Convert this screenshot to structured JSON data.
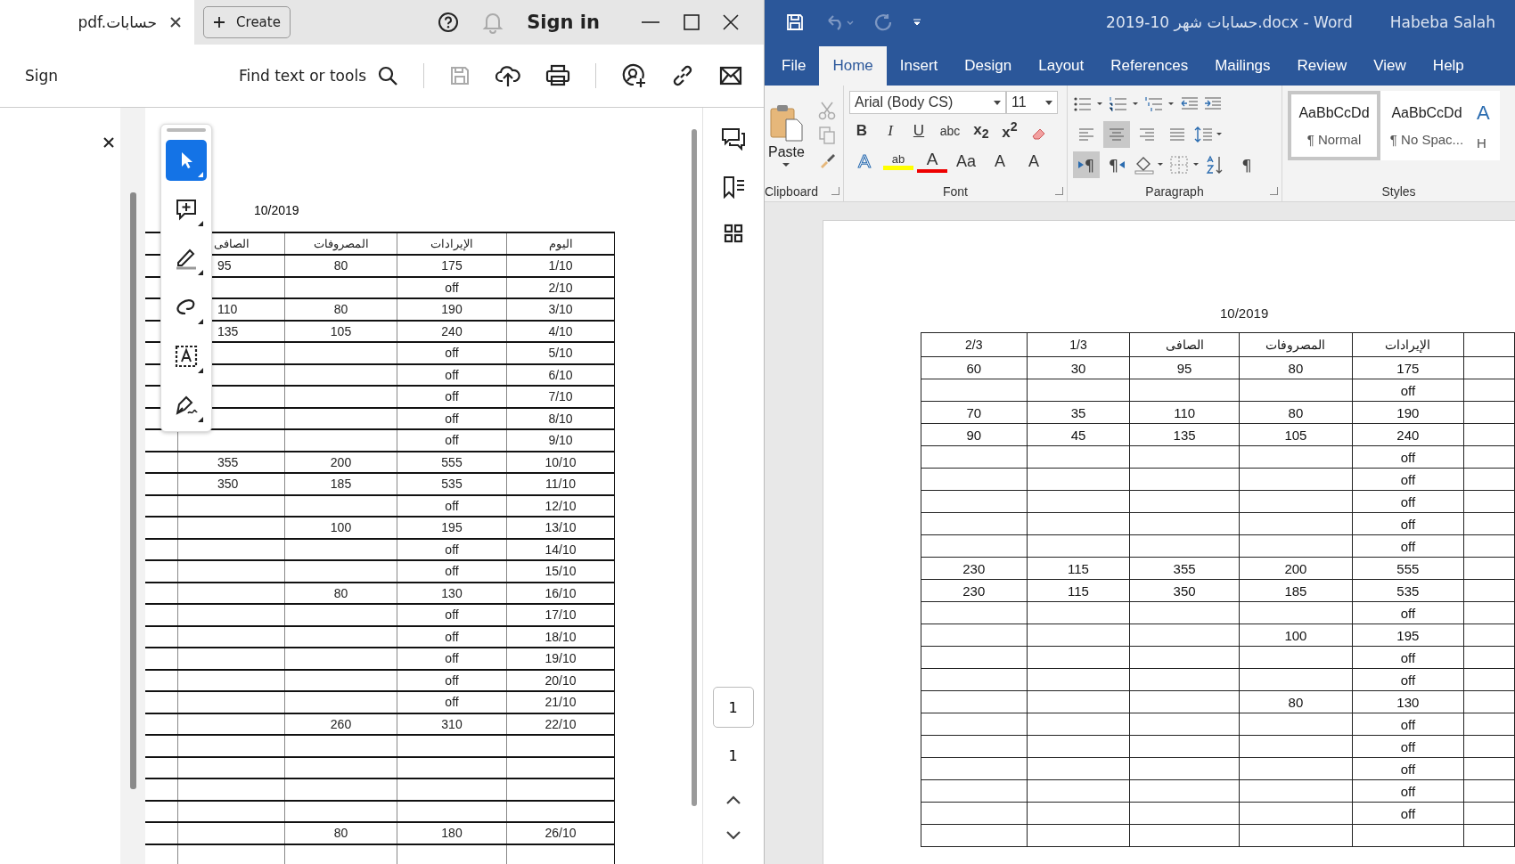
{
  "acrobat": {
    "tab": {
      "title": "pdf.حسابات",
      "selected": true
    },
    "create_button": "Create",
    "sign_in": "Sign in",
    "toolbar": {
      "sign": "Sign",
      "search": "Find text or tools",
      "icons": [
        {
          "kind": "save",
          "disabled": true
        },
        {
          "kind": "upload",
          "disabled": false
        },
        {
          "kind": "print",
          "disabled": false
        },
        {
          "kind": "share",
          "disabled": false
        },
        {
          "kind": "link",
          "disabled": false
        },
        {
          "kind": "mail",
          "disabled": false
        }
      ]
    },
    "tools": [
      {
        "kind": "select",
        "selected": true
      },
      {
        "kind": "comment",
        "selected": false
      },
      {
        "kind": "highlight",
        "selected": false
      },
      {
        "kind": "draw",
        "selected": false
      },
      {
        "kind": "textbox",
        "selected": false
      },
      {
        "kind": "sign",
        "selected": false
      }
    ],
    "document": {
      "date": "10/2019",
      "columns": [
        "الصافى",
        "المصروفات",
        "الإيرادات",
        "اليوم"
      ],
      "rows": [
        [
          "95",
          "80",
          "175",
          "1/10"
        ],
        [
          null,
          null,
          "off",
          "2/10"
        ],
        [
          "110",
          "80",
          "190",
          "3/10"
        ],
        [
          "135",
          "105",
          "240",
          "4/10"
        ],
        [
          null,
          null,
          "off",
          "5/10"
        ],
        [
          null,
          null,
          "off",
          "6/10"
        ],
        [
          null,
          null,
          "off",
          "7/10"
        ],
        [
          null,
          null,
          "off",
          "8/10"
        ],
        [
          null,
          null,
          "off",
          "9/10"
        ],
        [
          "355",
          "200",
          "555",
          "10/10"
        ],
        [
          "350",
          "185",
          "535",
          "11/10"
        ],
        [
          null,
          null,
          "off",
          "12/10"
        ],
        [
          null,
          "100",
          "195",
          "13/10"
        ],
        [
          null,
          null,
          "off",
          "14/10"
        ],
        [
          null,
          null,
          "off",
          "15/10"
        ],
        [
          null,
          "80",
          "130",
          "16/10"
        ],
        [
          null,
          null,
          "off",
          "17/10"
        ],
        [
          null,
          null,
          "off",
          "18/10"
        ],
        [
          null,
          null,
          "off",
          "19/10"
        ],
        [
          null,
          null,
          "off",
          "20/10"
        ],
        [
          null,
          null,
          "off",
          "21/10"
        ],
        [
          null,
          "260",
          "310",
          "22/10"
        ],
        [
          null,
          null,
          null,
          null
        ],
        [
          null,
          null,
          null,
          null
        ],
        [
          null,
          null,
          null,
          null
        ],
        [
          null,
          null,
          null,
          null
        ],
        [
          null,
          "80",
          "180",
          "26/10"
        ],
        [
          null,
          null,
          null,
          null
        ]
      ]
    },
    "page": {
      "current": "1",
      "total": "1"
    }
  },
  "word": {
    "title": "2019-10 حسابات شهر.docx  -  Word",
    "user": "Habeba Salah",
    "tabs": [
      {
        "label": "File",
        "selected": false
      },
      {
        "label": "Home",
        "selected": true
      },
      {
        "label": "Insert",
        "selected": false
      },
      {
        "label": "Design",
        "selected": false
      },
      {
        "label": "Layout",
        "selected": false
      },
      {
        "label": "References",
        "selected": false
      },
      {
        "label": "Mailings",
        "selected": false
      },
      {
        "label": "Review",
        "selected": false
      },
      {
        "label": "View",
        "selected": false
      },
      {
        "label": "Help",
        "selected": false
      }
    ],
    "paste": "Paste",
    "font": {
      "name": "Arial (Body CS)",
      "size": "11"
    },
    "font_buttons": [
      "B",
      "I",
      "U",
      "abc",
      "x$_{2}$",
      "x$^{2}$"
    ],
    "font_row2": [
      {
        "kind": "effects",
        "label": "A"
      },
      {
        "kind": "highlight",
        "label": "ab"
      },
      {
        "kind": "color",
        "label": "A"
      },
      {
        "kind": "case",
        "label": "Aa"
      },
      {
        "kind": "grow",
        "label": "A"
      },
      {
        "kind": "shrink",
        "label": "A"
      }
    ],
    "align": [
      {
        "kind": "left",
        "selected": false
      },
      {
        "kind": "center",
        "selected": true
      },
      {
        "kind": "right",
        "selected": false
      },
      {
        "kind": "justify",
        "selected": false
      }
    ],
    "direction": [
      {
        "kind": "ltr",
        "label": "¶",
        "selected": true
      },
      {
        "kind": "rtl",
        "label": "¶",
        "selected": false
      }
    ],
    "marks": "¶",
    "groups": [
      "Clipboard",
      "Font",
      "Paragraph",
      "Styles"
    ],
    "styles": [
      {
        "sample": "AaBbCcDd",
        "name": "¶ Normal",
        "selected": true
      },
      {
        "sample": "AaBbCcDd",
        "name": "¶ No Spac...",
        "selected": false
      },
      {
        "sample": "A",
        "name": "H",
        "selected": false
      }
    ],
    "document": {
      "date": "10/2019",
      "columns": [
        "2/3",
        "1/3",
        "الصافى",
        "المصروفات",
        "الإيرادات"
      ],
      "rows": [
        [
          "60",
          "30",
          "95",
          "80",
          "175"
        ],
        [
          null,
          null,
          null,
          null,
          "off"
        ],
        [
          "70",
          "35",
          "110",
          "80",
          "190"
        ],
        [
          "90",
          "45",
          "135",
          "105",
          "240"
        ],
        [
          null,
          null,
          null,
          null,
          "off"
        ],
        [
          null,
          null,
          null,
          null,
          "off"
        ],
        [
          null,
          null,
          null,
          null,
          "off"
        ],
        [
          null,
          null,
          null,
          null,
          "off"
        ],
        [
          null,
          null,
          null,
          null,
          "off"
        ],
        [
          "230",
          "115",
          "355",
          "200",
          "555"
        ],
        [
          "230",
          "115",
          "350",
          "185",
          "535"
        ],
        [
          null,
          null,
          null,
          null,
          "off"
        ],
        [
          null,
          null,
          null,
          "100",
          "195"
        ],
        [
          null,
          null,
          null,
          null,
          "off"
        ],
        [
          null,
          null,
          null,
          null,
          "off"
        ],
        [
          null,
          null,
          null,
          "80",
          "130"
        ],
        [
          null,
          null,
          null,
          null,
          "off"
        ],
        [
          null,
          null,
          null,
          null,
          "off"
        ],
        [
          null,
          null,
          null,
          null,
          "off"
        ],
        [
          null,
          null,
          null,
          null,
          "off"
        ],
        [
          null,
          null,
          null,
          null,
          "off"
        ],
        [
          null,
          null,
          null,
          null,
          null
        ]
      ]
    }
  }
}
